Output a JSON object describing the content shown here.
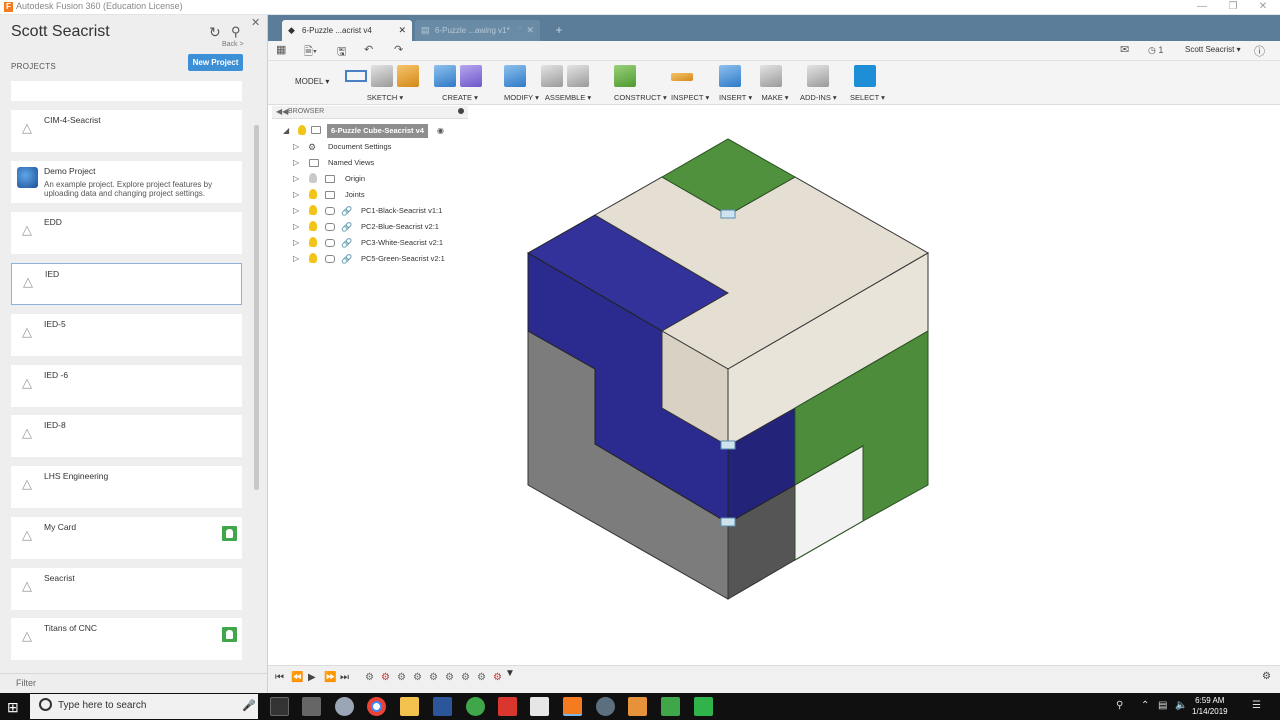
{
  "window": {
    "title": "Autodesk Fusion 360 (Education License)",
    "logo": "F"
  },
  "data_panel": {
    "user": "Scott Seacrist",
    "back_label": "Back >",
    "projects_heading": "PROJECTS",
    "new_project_label": "New Project",
    "filter_label": "Filter",
    "projects": [
      {
        "name": "CIM-4-Seacrist",
        "description": "",
        "shared": false
      },
      {
        "name": "Demo Project",
        "description": "An example project. Explore project features by uploading data and changing project settings.",
        "shared": false
      },
      {
        "name": "EDD",
        "description": "",
        "shared": false
      },
      {
        "name": "IED",
        "description": "",
        "shared": false
      },
      {
        "name": "IED-5",
        "description": "",
        "shared": false
      },
      {
        "name": "IED -6",
        "description": "",
        "shared": false
      },
      {
        "name": "IED-8",
        "description": "",
        "shared": false
      },
      {
        "name": "LHS Engineering",
        "description": "",
        "shared": false
      },
      {
        "name": "My Card",
        "description": "",
        "shared": true
      },
      {
        "name": "Seacrist",
        "description": "",
        "shared": false
      },
      {
        "name": "Titans of CNC",
        "description": "",
        "shared": true
      }
    ]
  },
  "tabs": [
    {
      "label": "6-Puzzle ...acrist v4",
      "active": true
    },
    {
      "label": "6-Puzzle ...awing v1*",
      "active": false
    }
  ],
  "quick_access": {
    "user": "Scott Seacrist",
    "jobs_count": "1"
  },
  "toolbar": {
    "workspace": "MODEL",
    "groups": [
      "SKETCH",
      "CREATE",
      "MODIFY",
      "ASSEMBLE",
      "CONSTRUCT",
      "INSPECT",
      "INSERT",
      "MAKE",
      "ADD-INS",
      "SELECT"
    ]
  },
  "browser": {
    "heading": "BROWSER",
    "root": "6-Puzzle Cube-Seacrist v4",
    "items": [
      "Document Settings",
      "Named Views",
      "Origin",
      "Joints",
      "PC1-Black-Seacrist v1:1",
      "PC2-Blue-Seacrist v2:1",
      "PC3-White-Seacrist v2:1",
      "PC5-Green-Seacrist v2:1"
    ]
  },
  "taskbar": {
    "search_placeholder": "Type here to search",
    "time": "6:59 AM",
    "date": "1/14/2019"
  },
  "colors": {
    "blue_piece": "#2f2f9e",
    "white_piece": "#e3ddd2",
    "green_piece": "#4e8f3c",
    "black_piece": "#7a7a7a",
    "accent": "#3d8fd6"
  }
}
